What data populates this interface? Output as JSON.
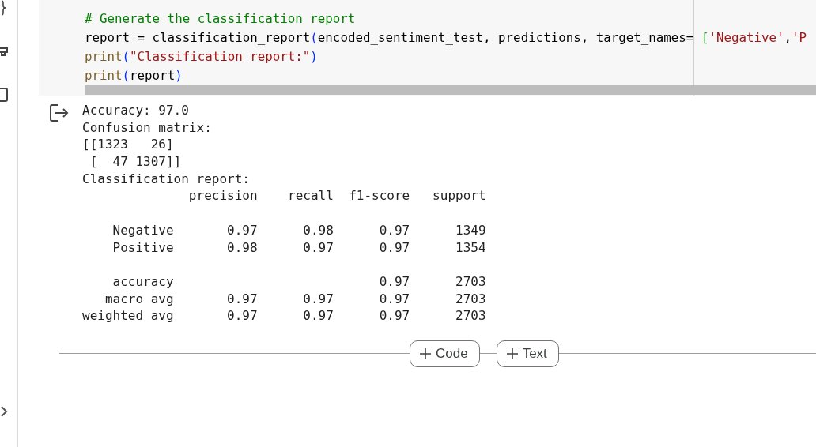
{
  "code_cell": {
    "lines": [
      [
        {
          "kind": "comment",
          "text": "# Generate the classification report"
        }
      ],
      [
        {
          "kind": "plain",
          "text": "report = classification_report"
        },
        {
          "kind": "paren",
          "text": "("
        },
        {
          "kind": "plain",
          "text": "encoded_sentiment_test, predictions, target_names= "
        },
        {
          "kind": "bracket",
          "text": "["
        },
        {
          "kind": "string",
          "text": "'Negative'"
        },
        {
          "kind": "plain",
          "text": ","
        },
        {
          "kind": "string",
          "text": "'P"
        }
      ],
      [
        {
          "kind": "builtin",
          "text": "print"
        },
        {
          "kind": "paren",
          "text": "("
        },
        {
          "kind": "string",
          "text": "\"Classification report:\""
        },
        {
          "kind": "paren",
          "text": ")"
        }
      ],
      [
        {
          "kind": "builtin",
          "text": "print"
        },
        {
          "kind": "paren",
          "text": "("
        },
        {
          "kind": "plain",
          "text": "report"
        },
        {
          "kind": "paren",
          "text": ")"
        }
      ]
    ]
  },
  "output": {
    "blocks": [
      [
        "Accuracy: 97.0",
        "Confusion matrix:",
        "[[1323   26]",
        " [  47 1307]]",
        "Classification report:",
        "              precision    recall  f1-score   support"
      ],
      [
        "    Negative       0.97      0.98      0.97      1349",
        "    Positive       0.98      0.97      0.97      1354"
      ],
      [
        "    accuracy                           0.97      2703",
        "   macro avg       0.97      0.97      0.97      2703",
        "weighted avg       0.97      0.97      0.97      2703"
      ]
    ]
  },
  "add_buttons": [
    {
      "label": "Code"
    },
    {
      "label": "Text"
    }
  ]
}
